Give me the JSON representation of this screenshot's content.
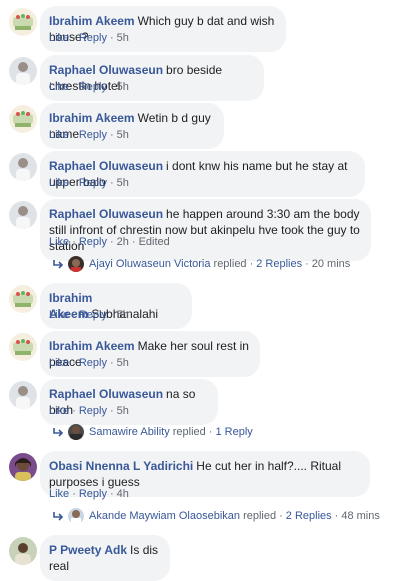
{
  "ui": {
    "like": "Like",
    "reply": "Reply",
    "dot": "·"
  },
  "comments": [
    {
      "author": "Ibrahim Akeem",
      "text": "Which guy b dat and wish house?",
      "time": "5h",
      "edited": "",
      "avatar": "cake-icon"
    },
    {
      "author": "Raphael Oluwaseun",
      "text": "bro beside chrestin hotel",
      "time": "5h",
      "edited": "",
      "avatar": "person-icon"
    },
    {
      "author": "Ibrahim Akeem",
      "text": "Wetin b d guy name",
      "time": "5h",
      "edited": "",
      "avatar": "cake-icon"
    },
    {
      "author": "Raphael Oluwaseun",
      "text": "i dont knw his name but he stay at upper balo",
      "time": "5h",
      "edited": "",
      "avatar": "person-icon"
    },
    {
      "author": "Raphael Oluwaseun",
      "text": "he happen around 3:30 am the body still infront of chrestin now but akinpelu hve took the guy to station",
      "time": "2h",
      "edited": "Edited",
      "avatar": "person-icon"
    },
    {
      "author": "Ibrahim Akeem",
      "text": "Subhanalahi",
      "time": "5h",
      "edited": "",
      "avatar": "cake-icon"
    },
    {
      "author": "Ibrahim Akeem",
      "text": "Make her soul rest in peace",
      "time": "5h",
      "edited": "",
      "avatar": "cake-icon"
    },
    {
      "author": "Raphael Oluwaseun",
      "text": "na so broh",
      "time": "5h",
      "edited": "",
      "avatar": "person-icon"
    },
    {
      "author": "Obasi Nnenna L Yadirichi",
      "text": "He cut her in half?.... Ritual purposes i guess",
      "time": "4h",
      "edited": "",
      "avatar": "woman-icon"
    },
    {
      "author": "P Pweety Adk",
      "text": "Is dis real",
      "time": "",
      "edited": "",
      "avatar": "man-icon"
    }
  ],
  "replies": [
    {
      "name": "Ajayi Oluwaseun Victoria",
      "verb": "replied",
      "count": "2 Replies",
      "time": "20 mins"
    },
    {
      "name": "Samawire Ability",
      "verb": "replied",
      "count": "1 Reply",
      "time": ""
    },
    {
      "name": "Akande Maywiam Olaosebikan",
      "verb": "replied",
      "count": "2 Replies",
      "time": "48 mins"
    }
  ],
  "colors": {
    "link": "#385898",
    "meta": "#606770",
    "bubble": "#f2f3f5"
  }
}
